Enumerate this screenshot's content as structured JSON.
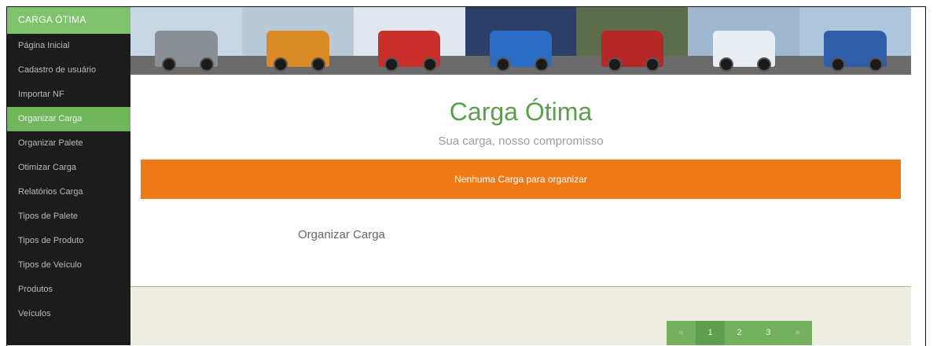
{
  "sidebar": {
    "brand": "CARGA ÓTIMA",
    "items": [
      {
        "label": "Página Inicial",
        "active": false
      },
      {
        "label": "Cadastro de usuário",
        "active": false
      },
      {
        "label": "Importar NF",
        "active": false
      },
      {
        "label": "Organizar Carga",
        "active": true
      },
      {
        "label": "Organizar Palete",
        "active": false
      },
      {
        "label": "Otimizar Carga",
        "active": false
      },
      {
        "label": "Relatórios Carga",
        "active": false
      },
      {
        "label": "Tipos de Palete",
        "active": false
      },
      {
        "label": "Tipos de Produto",
        "active": false
      },
      {
        "label": "Tipos de Veículo",
        "active": false
      },
      {
        "label": "Produtos",
        "active": false
      },
      {
        "label": "Veículos",
        "active": false
      }
    ]
  },
  "banner": {
    "photos": [
      {
        "sky": "#c9d6e3",
        "truck": "#8a8f96"
      },
      {
        "sky": "#b9c9d8",
        "truck": "#d98a25"
      },
      {
        "sky": "#dfe6ee",
        "truck": "#c9302c"
      },
      {
        "sky": "#2c3f66",
        "truck": "#2b6cc4"
      },
      {
        "sky": "#5d6c4a",
        "truck": "#b82727"
      },
      {
        "sky": "#9fb8cf",
        "truck": "#e8eef3"
      },
      {
        "sky": "#aec6dc",
        "truck": "#2f5ea8"
      }
    ]
  },
  "header": {
    "title": "Carga Ótima",
    "subtitle": "Sua carga, nosso compromisso"
  },
  "alert": {
    "message": "Nenhuma Carga para organizar",
    "color": "#ee7915"
  },
  "main": {
    "section_title": "Organizar Carga"
  },
  "pagination": {
    "prev": "«",
    "pages": [
      "1",
      "2",
      "3"
    ],
    "current": "1",
    "next": "»"
  },
  "colors": {
    "accent": "#6fb65d",
    "title": "#5c9e4d",
    "sidebar_bg": "#1c1c1c"
  }
}
